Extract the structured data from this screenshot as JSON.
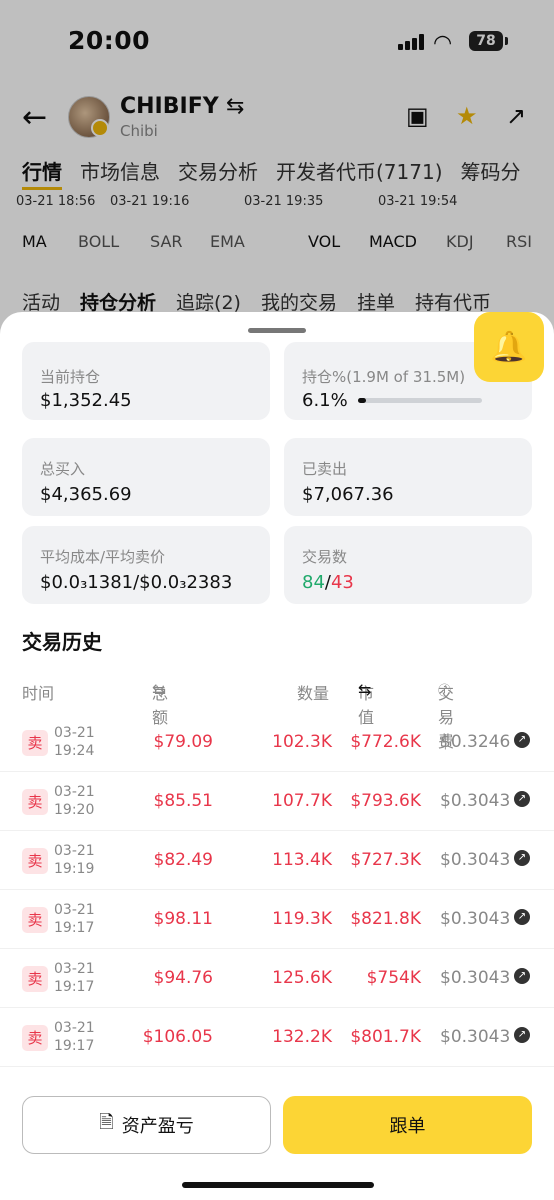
{
  "status_bar": {
    "time": "20:00",
    "battery": "78"
  },
  "header": {
    "token_name": "CHIBIFY",
    "token_sub": "Chibi"
  },
  "top_tabs": [
    "行情",
    "市场信息",
    "交易分析",
    "开发者代币(7171)",
    "筹码分"
  ],
  "chart_dates": [
    "03-21 18:56",
    "03-21 19:16",
    "03-21 19:35",
    "03-21 19:54"
  ],
  "indicators": [
    "MA",
    "BOLL",
    "SAR",
    "EMA",
    "VOL",
    "MACD",
    "KDJ",
    "RSI"
  ],
  "sub_tabs": [
    "活动",
    "持仓分析",
    "追踪(2)",
    "我的交易",
    "挂单",
    "持有代币"
  ],
  "stats": {
    "current_holding_label": "当前持仓",
    "current_holding_value": "$1,352.45",
    "holding_pct_label": "持仓%(1.9M of 31.5M)",
    "holding_pct_value": "6.1%",
    "holding_pct_fraction": 0.061,
    "total_buy_label": "总买入",
    "total_buy_value": "$4,365.69",
    "sold_label": "已卖出",
    "sold_value": "$7,067.36",
    "avg_label": "平均成本/平均卖价",
    "avg_value": "$0.0₃1381/$0.0₃2383",
    "trades_label": "交易数",
    "trades_buy": "84",
    "trades_sep": "/",
    "trades_sell": "43"
  },
  "history": {
    "title": "交易历史",
    "columns": {
      "time": "时间",
      "total": "总额",
      "qty": "数量",
      "mcap": "市值",
      "fee": "交易费"
    },
    "rows": [
      {
        "type": "卖",
        "date": "03-21",
        "time": "19:24",
        "total": "$79.09",
        "qty": "102.3K",
        "mcap": "$772.6K",
        "fee": "$0.3246"
      },
      {
        "type": "卖",
        "date": "03-21",
        "time": "19:20",
        "total": "$85.51",
        "qty": "107.7K",
        "mcap": "$793.6K",
        "fee": "$0.3043"
      },
      {
        "type": "卖",
        "date": "03-21",
        "time": "19:19",
        "total": "$82.49",
        "qty": "113.4K",
        "mcap": "$727.3K",
        "fee": "$0.3043"
      },
      {
        "type": "卖",
        "date": "03-21",
        "time": "19:17",
        "total": "$98.11",
        "qty": "119.3K",
        "mcap": "$821.8K",
        "fee": "$0.3043"
      },
      {
        "type": "卖",
        "date": "03-21",
        "time": "19:17",
        "total": "$94.76",
        "qty": "125.6K",
        "mcap": "$754K",
        "fee": "$0.3043"
      },
      {
        "type": "卖",
        "date": "03-21",
        "time": "19:17",
        "total": "$106.05",
        "qty": "132.2K",
        "mcap": "$801.7K",
        "fee": "$0.3043"
      }
    ]
  },
  "footer": {
    "pnl_label": "资产盈亏",
    "copy_label": "跟单"
  },
  "colors": {
    "accent": "#fcd535",
    "buy": "#20a96b",
    "sell": "#e8364a"
  }
}
